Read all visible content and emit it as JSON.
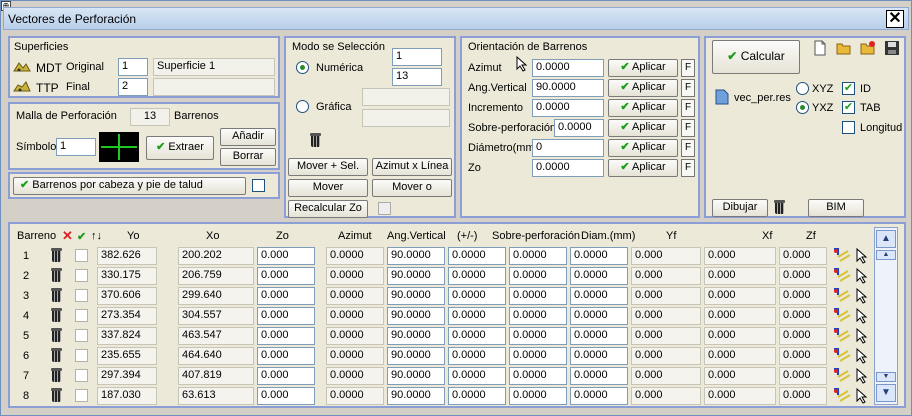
{
  "window": {
    "title": "Vectores de Perforación",
    "pin_glyph": "⊕",
    "close_glyph": "✕"
  },
  "superficies": {
    "title": "Superficies",
    "rows": [
      {
        "type": "MDT",
        "name": "Original",
        "num": "1",
        "value": "Superficie 1"
      },
      {
        "type": "TTP",
        "name": "Final",
        "num": "2",
        "value": ""
      }
    ]
  },
  "malla": {
    "label": "Malla de Perforación",
    "count": "13",
    "unit": "Barrenos",
    "symbol_label": "Símbolo",
    "symbol_value": "1",
    "extraer": "Extraer",
    "anadir": "Añadir",
    "borrar": "Borrar"
  },
  "talud": {
    "label": "Barrenos por cabeza y pie de talud",
    "checked": false
  },
  "modo": {
    "title": "Modo se Selección",
    "numerica": "Numérica",
    "grafica": "Gráfica",
    "selected": "numerica",
    "num1": "1",
    "num2": "13",
    "mover_sel": "Mover + Sel.",
    "azimut_linea": "Azimut x Línea",
    "mover": "Mover",
    "mover_o": "Mover o",
    "recalcular": "Recalcular Zo"
  },
  "orientacion": {
    "title": "Orientación de Barrenos",
    "aplicar": "Aplicar",
    "f": "F",
    "fields": [
      {
        "label": "Azimut",
        "value": "0.0000"
      },
      {
        "label": "Ang.Vertical",
        "value": "90.0000"
      },
      {
        "label": "Incremento",
        "value": "0.0000"
      },
      {
        "label": "Sobre-perforación",
        "value": "0.0000"
      },
      {
        "label": "Diámetro(mm)",
        "value": "0"
      },
      {
        "label": "Zo",
        "value": "0.0000"
      }
    ]
  },
  "calc": {
    "calcular": "Calcular",
    "file": "vec_per.res",
    "xyz": "XYZ",
    "yxz": "YXZ",
    "coord_selected": "YXZ",
    "id": "ID",
    "tab": "TAB",
    "longitud": "Longitud",
    "id_checked": true,
    "tab_checked": true,
    "longitud_checked": false,
    "dibujar": "Dibujar",
    "bim": "BIM"
  },
  "table": {
    "headers": [
      "Barreno",
      "Yo",
      "Xo",
      "Zo",
      "Azimut",
      "Ang.Vertical",
      "(+/-)",
      "Sobre-perforación",
      "Diam.(mm)",
      "Yf",
      "Xf",
      "Zf"
    ],
    "rows": [
      {
        "n": "1",
        "yo": "382.626",
        "xo": "200.202",
        "zo": "0.000",
        "az": "0.0000",
        "av": "90.0000",
        "pm": "0.0000",
        "sp": "0.0000",
        "d": "0.0000",
        "yf": "0.000",
        "xf": "0.000",
        "zf": "0.000"
      },
      {
        "n": "2",
        "yo": "330.175",
        "xo": "206.759",
        "zo": "0.000",
        "az": "0.0000",
        "av": "90.0000",
        "pm": "0.0000",
        "sp": "0.0000",
        "d": "0.0000",
        "yf": "0.000",
        "xf": "0.000",
        "zf": "0.000"
      },
      {
        "n": "3",
        "yo": "370.606",
        "xo": "299.640",
        "zo": "0.000",
        "az": "0.0000",
        "av": "90.0000",
        "pm": "0.0000",
        "sp": "0.0000",
        "d": "0.0000",
        "yf": "0.000",
        "xf": "0.000",
        "zf": "0.000"
      },
      {
        "n": "4",
        "yo": "273.354",
        "xo": "304.557",
        "zo": "0.000",
        "az": "0.0000",
        "av": "90.0000",
        "pm": "0.0000",
        "sp": "0.0000",
        "d": "0.0000",
        "yf": "0.000",
        "xf": "0.000",
        "zf": "0.000"
      },
      {
        "n": "5",
        "yo": "337.824",
        "xo": "463.547",
        "zo": "0.000",
        "az": "0.0000",
        "av": "90.0000",
        "pm": "0.0000",
        "sp": "0.0000",
        "d": "0.0000",
        "yf": "0.000",
        "xf": "0.000",
        "zf": "0.000"
      },
      {
        "n": "6",
        "yo": "235.655",
        "xo": "464.640",
        "zo": "0.000",
        "az": "0.0000",
        "av": "90.0000",
        "pm": "0.0000",
        "sp": "0.0000",
        "d": "0.0000",
        "yf": "0.000",
        "xf": "0.000",
        "zf": "0.000"
      },
      {
        "n": "7",
        "yo": "297.394",
        "xo": "407.819",
        "zo": "0.000",
        "az": "0.0000",
        "av": "90.0000",
        "pm": "0.0000",
        "sp": "0.0000",
        "d": "0.0000",
        "yf": "0.000",
        "xf": "0.000",
        "zf": "0.000"
      },
      {
        "n": "8",
        "yo": "187.030",
        "xo": "63.613",
        "zo": "0.000",
        "az": "0.0000",
        "av": "90.0000",
        "pm": "0.0000",
        "sp": "0.0000",
        "d": "0.0000",
        "yf": "0.000",
        "xf": "0.000",
        "zf": "0.000"
      }
    ]
  },
  "colors": {
    "panel_border": "#8c9ed6",
    "check_green": "#1b9e1b",
    "title_bg": "#c8daf0"
  }
}
